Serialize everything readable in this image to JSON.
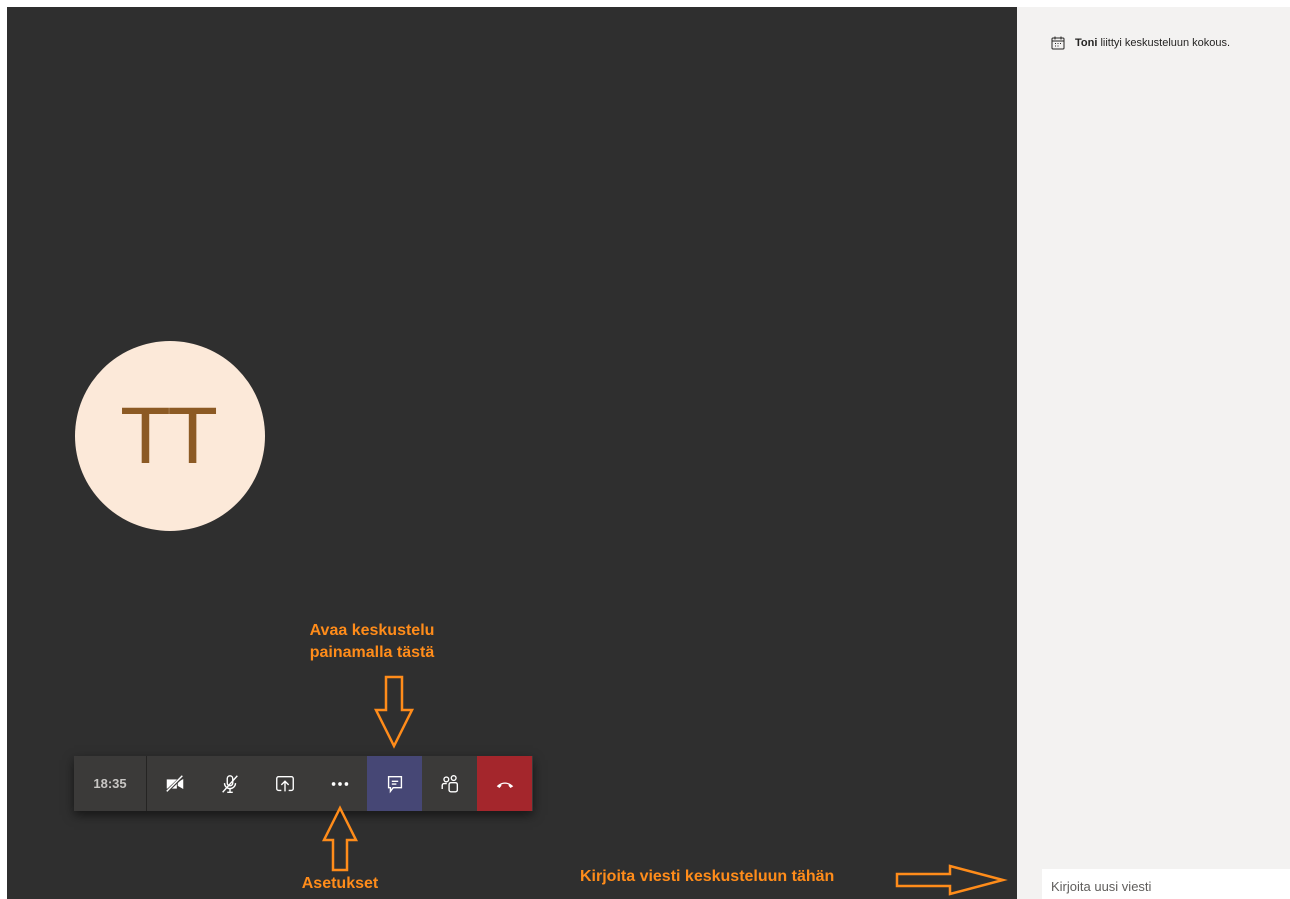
{
  "avatar": {
    "initials": "TT"
  },
  "callbar": {
    "time": "18:35",
    "buttons": [
      {
        "name": "camera-off",
        "icon": "video-off-icon"
      },
      {
        "name": "mic-off",
        "icon": "mic-off-icon"
      },
      {
        "name": "share",
        "icon": "share-screen-icon"
      },
      {
        "name": "more",
        "icon": "more-icon"
      },
      {
        "name": "chat",
        "icon": "chat-icon"
      },
      {
        "name": "participants",
        "icon": "people-icon"
      },
      {
        "name": "hang-up",
        "icon": "phone-hangup-icon"
      }
    ]
  },
  "annotations": {
    "open_chat_line1": "Avaa keskustelu",
    "open_chat_line2": "painamalla tästä",
    "settings": "Asetukset",
    "write_message": "Kirjoita viesti keskusteluun tähän"
  },
  "chat": {
    "message_sender": "Toni",
    "message_text": " liittyi keskusteluun kokous.",
    "compose_placeholder": "Kirjoita uusi viesti"
  },
  "colors": {
    "stage_bg": "#2f2f2f",
    "callbar_bg": "#3b3a39",
    "chat_active": "#464775",
    "hangup": "#a4262c",
    "annotation": "#ff8c1a",
    "avatar_bg": "#fce9d9",
    "avatar_text": "#8c5a24",
    "sidebar_bg": "#f3f2f1"
  }
}
